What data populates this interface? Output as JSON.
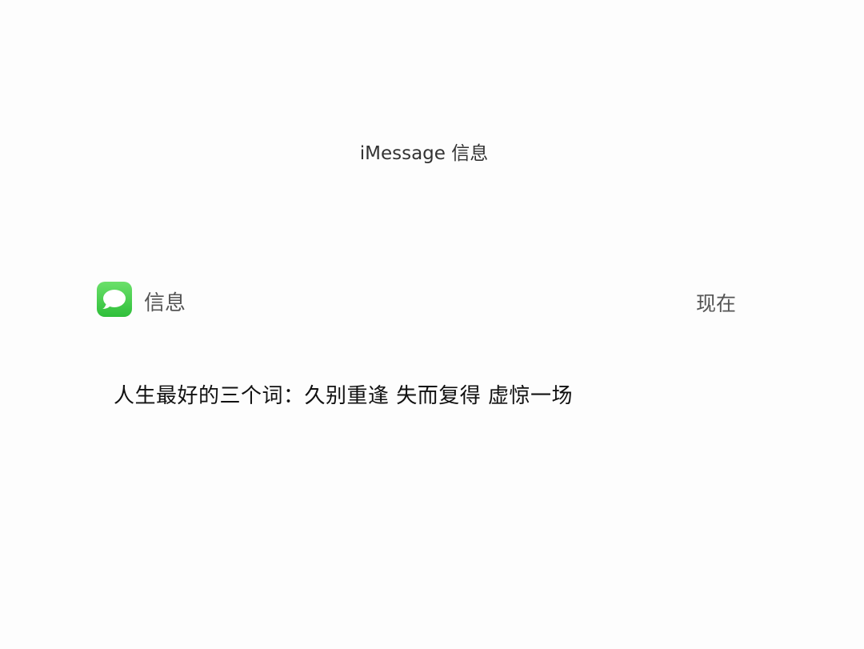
{
  "header": {
    "title": "iMessage 信息"
  },
  "notification": {
    "app_icon": "messages-icon",
    "app_name": "信息",
    "time": "现在",
    "message": "人生最好的三个词：久别重逢 失而复得 虚惊一场"
  }
}
